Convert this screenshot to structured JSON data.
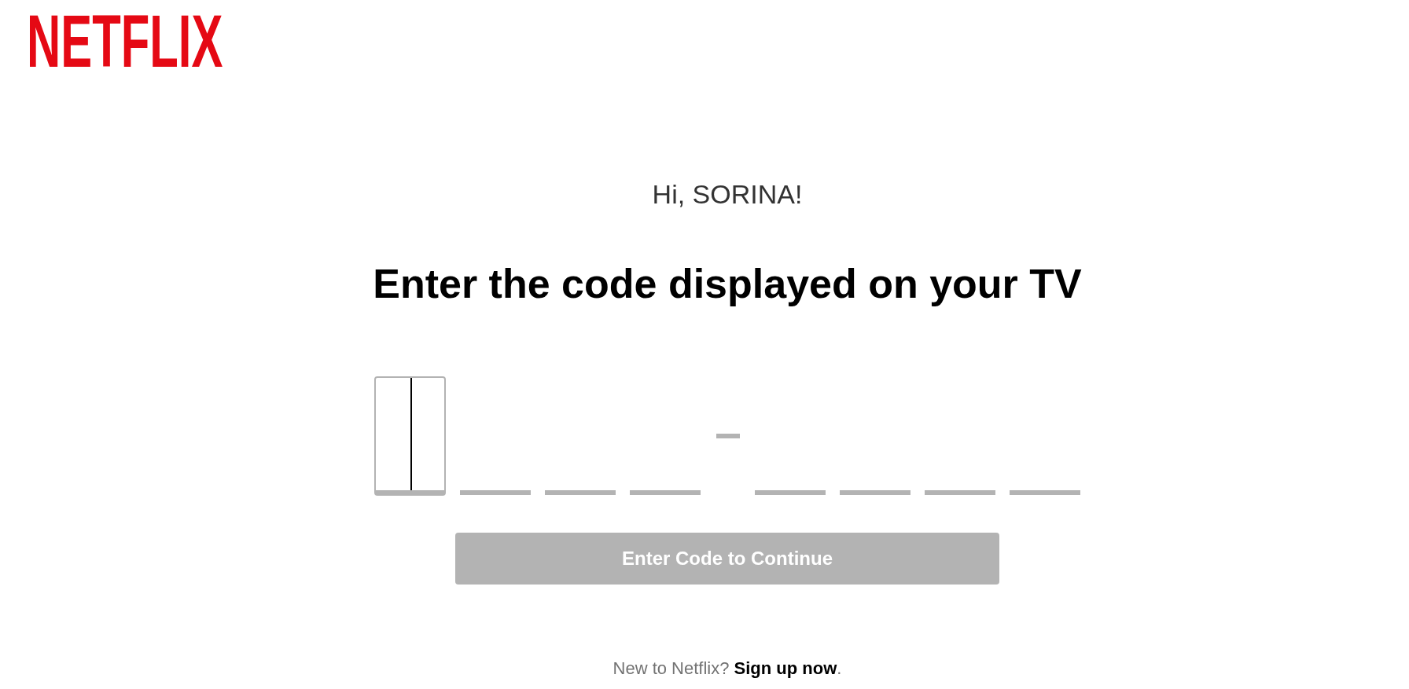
{
  "header": {
    "logo": "NETFLIX"
  },
  "greeting": "Hi, SORINA!",
  "heading": "Enter the code displayed on your TV",
  "code_groups": [
    {
      "slots": [
        {
          "focused": true
        },
        {
          "focused": false
        },
        {
          "focused": false
        },
        {
          "focused": false
        }
      ]
    },
    {
      "slots": [
        {
          "focused": false
        },
        {
          "focused": false
        },
        {
          "focused": false
        },
        {
          "focused": false
        }
      ]
    }
  ],
  "continue_button": {
    "label": "Enter Code to Continue",
    "disabled": true
  },
  "footer": {
    "prompt": "New to Netflix?",
    "link": "Sign up now",
    "suffix": "."
  }
}
